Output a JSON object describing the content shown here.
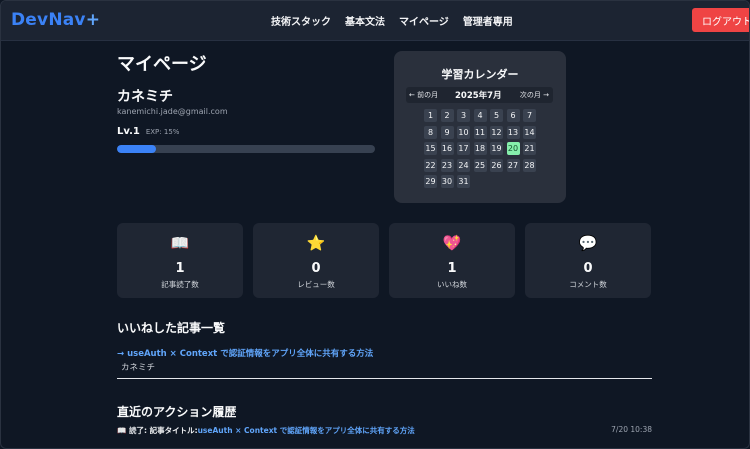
{
  "header": {
    "logo_text": "DevNav",
    "logo_plus": "+",
    "nav": [
      "技術スタック",
      "基本文法",
      "マイページ",
      "管理者専用"
    ],
    "logout_label": "ログアウト",
    "colors": {
      "brand": "#3b82f6",
      "logout": "#ef4444"
    }
  },
  "profile": {
    "page_title": "マイページ",
    "name": "カネミチ",
    "email": "kanemichi.jade@gmail.com",
    "level": "Lv.1",
    "exp": "EXP: 15%",
    "exp_fraction": 0.15
  },
  "calendar": {
    "title": "学習カレンダー",
    "prev_label": "← 前の月",
    "month_label": "2025年7月",
    "next_label": "次の月 →",
    "days": [
      "1",
      "2",
      "3",
      "4",
      "5",
      "6",
      "7",
      "8",
      "9",
      "10",
      "11",
      "12",
      "13",
      "14",
      "15",
      "16",
      "17",
      "18",
      "19",
      "20",
      "21",
      "22",
      "23",
      "24",
      "25",
      "26",
      "27",
      "28",
      "29",
      "30",
      "31"
    ],
    "highlighted_day": "20",
    "highlight_color": "#86efac"
  },
  "stats": [
    {
      "icon": "book-icon",
      "glyph": "📖",
      "value": "1",
      "label": "記事読了数"
    },
    {
      "icon": "star-icon",
      "glyph": "⭐",
      "value": "0",
      "label": "レビュー数"
    },
    {
      "icon": "heart-icon",
      "glyph": "💖",
      "value": "1",
      "label": "いいね数"
    },
    {
      "icon": "comment-icon",
      "glyph": "💬",
      "value": "0",
      "label": "コメント数"
    }
  ],
  "liked": {
    "section_title": "いいねした記事一覧",
    "items": [
      {
        "title": "→ useAuth × Context で認証情報をアプリ全体に共有する方法",
        "author": "カネミチ"
      }
    ]
  },
  "actions": {
    "section_title": "直近のアクション履歴",
    "items": [
      {
        "kind": "📖 読了:",
        "title_label": "記事タイトル:",
        "title": "useAuth × Context で認証情報をアプリ全体に共有する方法",
        "time": "7/20 10:38"
      }
    ]
  }
}
